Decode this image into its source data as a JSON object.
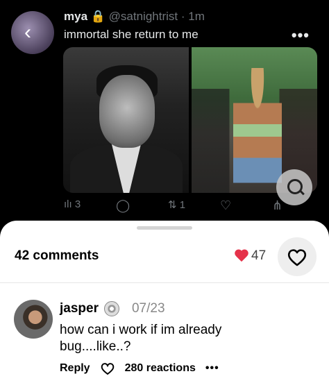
{
  "tweet": {
    "display_name": "mya",
    "handle": "@satnightrist",
    "time": "1m",
    "text": "immortal she return to me",
    "more": "•••",
    "stats": {
      "views": "3",
      "retweets": "1"
    }
  },
  "sheet": {
    "comments_label": "42 comments",
    "reaction_count": "47"
  },
  "comment": {
    "username": "jasper",
    "date": "07/23",
    "text": "how can i work if im already bug....like..?",
    "reply_label": "Reply",
    "reactions_label": "280 reactions",
    "more": "•••"
  }
}
